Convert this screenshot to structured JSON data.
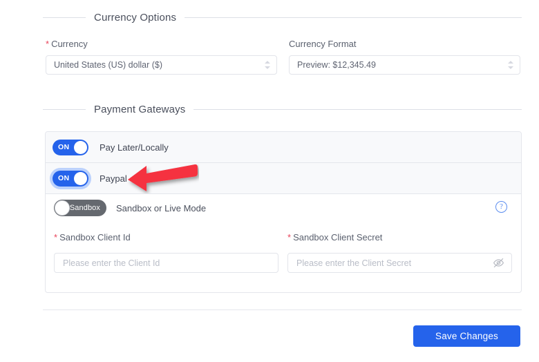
{
  "currency_section": {
    "title": "Currency Options",
    "currency_field": {
      "label": "Currency",
      "required_marker": "*",
      "value": "United States (US) dollar ($)"
    },
    "currency_format_field": {
      "label": "Currency Format",
      "value": "Preview: $12,345.49"
    }
  },
  "gateways_section": {
    "title": "Payment Gateways",
    "gateways": [
      {
        "name": "Pay Later/Locally",
        "toggle_state": "ON",
        "focused": false
      },
      {
        "name": "Paypal",
        "toggle_state": "ON",
        "focused": true
      }
    ],
    "paypal_panel": {
      "mode_toggle_label": "Sandbox",
      "mode_caption": "Sandbox or Live Mode",
      "help_icon": "question-mark-circle-icon",
      "client_id": {
        "label": "Sandbox Client Id",
        "required_marker": "*",
        "placeholder": "Please enter the Client Id",
        "value": ""
      },
      "client_secret": {
        "label": "Sandbox Client Secret",
        "required_marker": "*",
        "placeholder": "Please enter the Client Secret",
        "value": "",
        "reveal_icon": "eye-slash-icon"
      }
    }
  },
  "footer": {
    "save_label": "Save Changes"
  },
  "annotation": {
    "type": "arrow-left",
    "color": "#f5333f"
  },
  "colors": {
    "accent": "#2563eb",
    "required": "#e8435a",
    "row_bg": "#f8f9fb",
    "border": "#e4e6ec",
    "annotation_red": "#f5333f"
  }
}
